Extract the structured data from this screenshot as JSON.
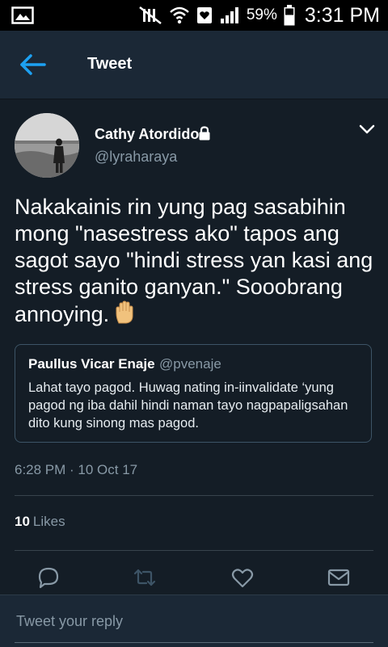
{
  "status_bar": {
    "battery_percent": "59%",
    "time": "3:31 PM",
    "icons": [
      "image-icon",
      "mute-icon",
      "wifi-icon",
      "heart-notification-icon",
      "signal-icon",
      "battery-icon"
    ]
  },
  "header": {
    "title": "Tweet",
    "back_icon": "back-arrow-icon"
  },
  "tweet": {
    "author_name": "Cathy Atordido",
    "author_handle": "@lyraharaya",
    "protected": true,
    "text": "Nakakainis rin yung pag sasabihin mong \"nasestress ako\" tapos ang sagot sayo \"hindi stress yan kasi ang stress ganito ganyan.\" Sooobrang annoying.",
    "emoji": "raised-hand-emoji",
    "quoted": {
      "author_name": "Paullus Vicar Enaje",
      "author_handle": "@pvenaje",
      "text": "Lahat tayo pagod. Huwag nating in-iinvalidate ‘yung pagod ng iba dahil hindi naman tayo nagpapaligsahan dito kung sinong mas pagod."
    },
    "timestamp": "6:28 PM · 10 Oct 17",
    "likes_count": "10",
    "likes_label": "Likes"
  },
  "actions": [
    "reply-icon",
    "retweet-icon",
    "like-icon",
    "message-icon"
  ],
  "reply": {
    "placeholder": "Tweet your reply"
  },
  "colors": {
    "background": "#141d26",
    "header": "#1b2836",
    "accent": "#1da1f2",
    "secondary_text": "#8899a6",
    "divider": "#38444d"
  }
}
